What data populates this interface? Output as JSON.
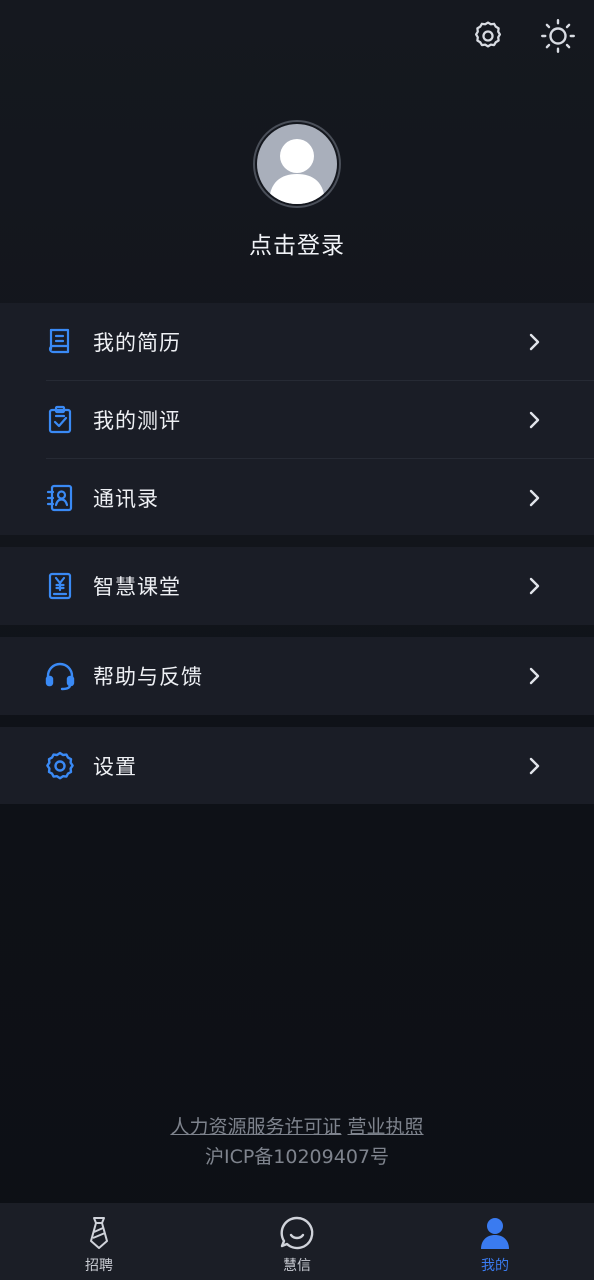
{
  "header": {
    "settings_icon": "gear-icon",
    "theme_icon": "sun-icon"
  },
  "profile": {
    "login_label": "点击登录",
    "avatar_icon": "default-avatar"
  },
  "menu_group_1": [
    {
      "label": "我的简历",
      "icon": "resume-icon"
    },
    {
      "label": "我的测评",
      "icon": "assessment-clipboard-icon"
    },
    {
      "label": "通讯录",
      "icon": "contacts-book-icon"
    }
  ],
  "menu_group_2": [
    {
      "label": "智慧课堂",
      "icon": "yuan-book-icon"
    }
  ],
  "menu_group_3": [
    {
      "label": "帮助与反馈",
      "icon": "headset-icon"
    }
  ],
  "menu_group_4": [
    {
      "label": "设置",
      "icon": "gear-icon"
    }
  ],
  "footer": {
    "license_link_1": "人力资源服务许可证",
    "license_link_2": "营业执照",
    "icp": "沪ICP备10209407号"
  },
  "tabbar": [
    {
      "label": "招聘",
      "icon": "tie-icon",
      "active": false
    },
    {
      "label": "慧信",
      "icon": "chat-bubble-icon",
      "active": false
    },
    {
      "label": "我的",
      "icon": "person-icon",
      "active": true
    }
  ],
  "colors": {
    "accent": "#3a7bf0",
    "background": "#0e1117",
    "card": "#1a1d26"
  }
}
